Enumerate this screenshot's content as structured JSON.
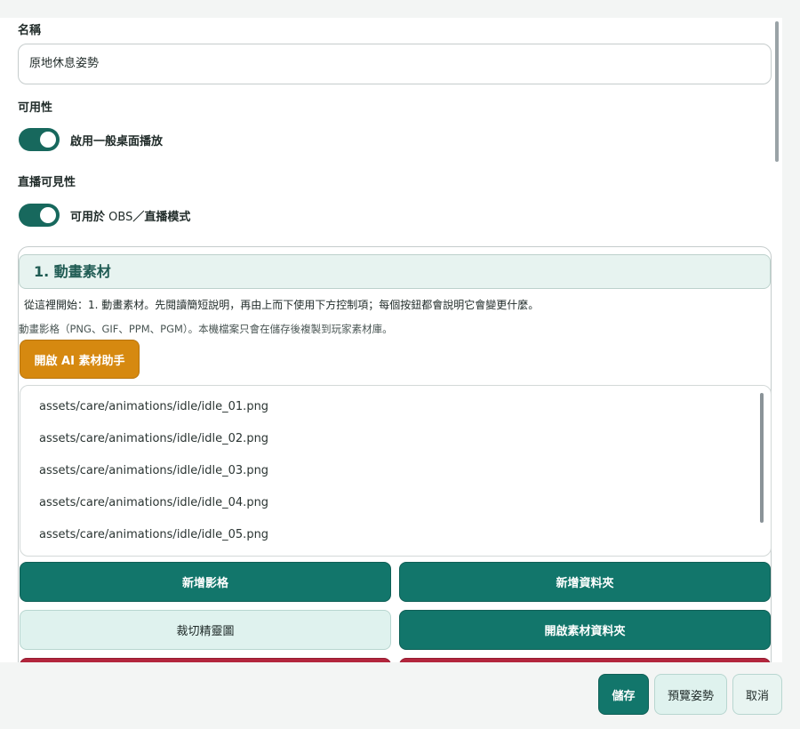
{
  "form": {
    "name_label": "名稱",
    "name_value": "原地休息姿勢",
    "availability_label": "可用性",
    "availability_toggle_label": "啟用一般桌面播放",
    "stream_visibility_label": "直播可見性",
    "stream_toggle_label_bold": "可用於",
    "stream_toggle_label_light": " OBS",
    "stream_toggle_label_rest": "／直播模式",
    "availability_enabled": true,
    "stream_enabled": true
  },
  "section": {
    "title": "1. 動畫素材",
    "intro": "從這裡開始：1. 動畫素材。先閱讀簡短說明，再由上而下使用下方控制項；每個按鈕都會說明它會變更什麼。",
    "hint": "動畫影格（PNG、GIF、PPM、PGM）。本機檔案只會在儲存後複製到玩家素材庫。",
    "ai_button_label": "開啟 AI 素材助手",
    "files": [
      "assets/care/animations/idle/idle_01.png",
      "assets/care/animations/idle/idle_02.png",
      "assets/care/animations/idle/idle_03.png",
      "assets/care/animations/idle/idle_04.png",
      "assets/care/animations/idle/idle_05.png"
    ],
    "buttons": {
      "add_frame": "新增影格",
      "add_folder": "新增資料夾",
      "crop_sprite": "裁切精靈圖",
      "open_asset_folder": "開啟素材資料夾"
    }
  },
  "footer": {
    "save": "儲存",
    "preview": "預覽姿勢",
    "cancel": "取消"
  },
  "colors": {
    "primary": "#12766b",
    "accent": "#d68910",
    "danger": "#b3263d",
    "light": "#dff2ee"
  }
}
